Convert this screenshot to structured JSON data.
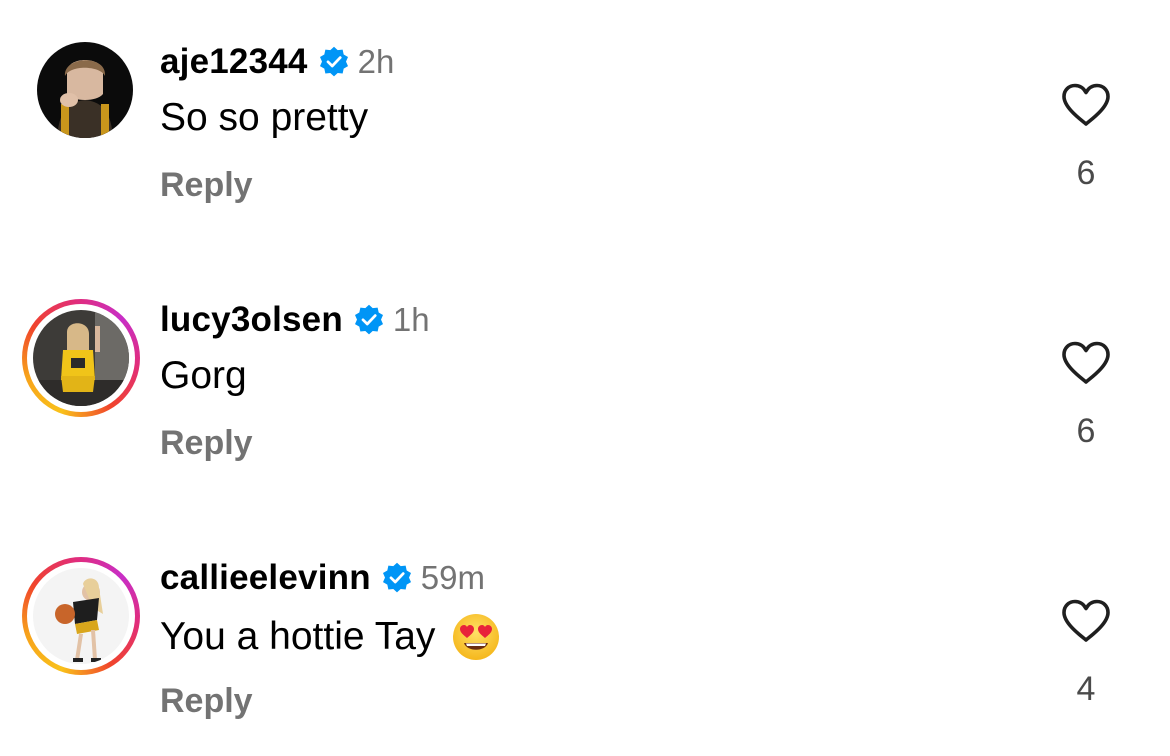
{
  "comments": [
    {
      "username": "aje12344",
      "verified": true,
      "time": "2h",
      "text": "So so pretty",
      "reply_label": "Reply",
      "likes": "6",
      "story_ring": false
    },
    {
      "username": "lucy3olsen",
      "verified": true,
      "time": "1h",
      "text": "Gorg",
      "reply_label": "Reply",
      "likes": "6",
      "story_ring": true
    },
    {
      "username": "callieelevinn",
      "verified": true,
      "time": "59m",
      "text": "You a hottie Tay",
      "emoji": "heart-eyes-emoji",
      "reply_label": "Reply",
      "likes": "4",
      "story_ring": true
    }
  ],
  "colors": {
    "verified_blue": "#0095f6",
    "secondary_text": "#737373",
    "ring_gradient": [
      "#f9c11b",
      "#f0442b",
      "#e12d7a",
      "#c82ec7"
    ]
  },
  "icons": {
    "like": "heart-outline-icon",
    "verified": "verified-badge-icon"
  }
}
